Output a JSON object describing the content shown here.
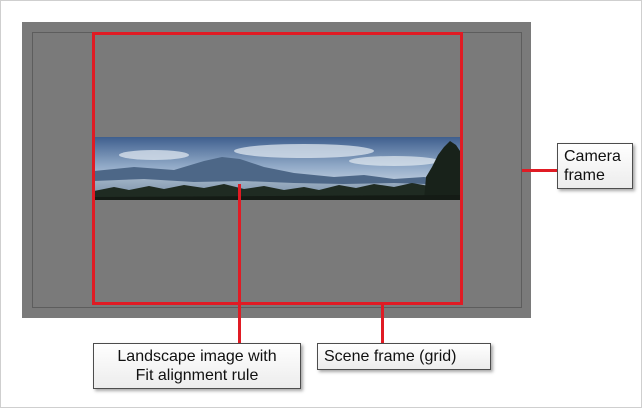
{
  "callouts": {
    "camera_frame": {
      "line1": "Camera",
      "line2": "frame"
    },
    "landscape_image": {
      "line1": "Landscape image with",
      "line2": "Fit alignment rule"
    },
    "scene_frame": {
      "label": "Scene frame (grid)"
    }
  },
  "colors": {
    "camera_background": "#7a7a7a",
    "camera_border": "#5d5d5d",
    "scene_frame": "#e01b24",
    "callout_border": "#4d4d4d"
  }
}
